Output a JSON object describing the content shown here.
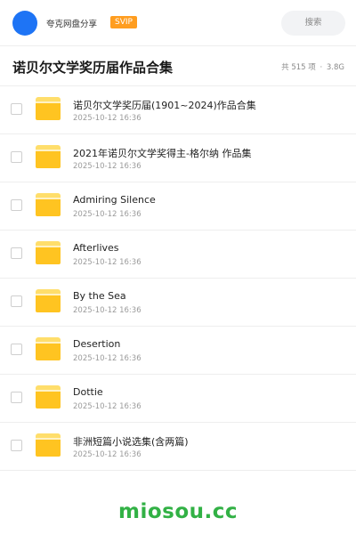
{
  "topbar": {
    "brand": "夸克网盘分享",
    "badge": "SVIP",
    "search_label": "搜索"
  },
  "header": {
    "title": "诺贝尔文学奖历届作品合集",
    "count": "共 515 项",
    "separator": "·",
    "size": "3.8G"
  },
  "files": [
    {
      "name": "诺贝尔文学奖历届(1901~2024)作品合集",
      "date": "2025-10-12 16:36",
      "icon": "folder-icon",
      "checked": false
    },
    {
      "name": "2021年诺贝尔文学奖得主-格尔纳 作品集",
      "date": "2025-10-12 16:36",
      "icon": "folder-icon",
      "checked": false
    },
    {
      "name": "Admiring Silence",
      "date": "2025-10-12 16:36",
      "icon": "folder-icon",
      "checked": false
    },
    {
      "name": "Afterlives",
      "date": "2025-10-12 16:36",
      "icon": "folder-icon",
      "checked": false
    },
    {
      "name": "By the Sea",
      "date": "2025-10-12 16:36",
      "icon": "folder-icon",
      "checked": false
    },
    {
      "name": "Desertion",
      "date": "2025-10-12 16:36",
      "icon": "folder-icon",
      "checked": false
    },
    {
      "name": "Dottie",
      "date": "2025-10-12 16:36",
      "icon": "folder-icon",
      "checked": false
    },
    {
      "name": "非洲短篇小说选集(含两篇)",
      "date": "2025-10-12 16:36",
      "icon": "folder-icon",
      "checked": false
    }
  ],
  "watermark": "miosou.cc",
  "colors": {
    "avatar": "#1e74f5",
    "svip_badge": "#ff9d1f",
    "folder": "#ffc421",
    "watermark": "#32b145"
  }
}
